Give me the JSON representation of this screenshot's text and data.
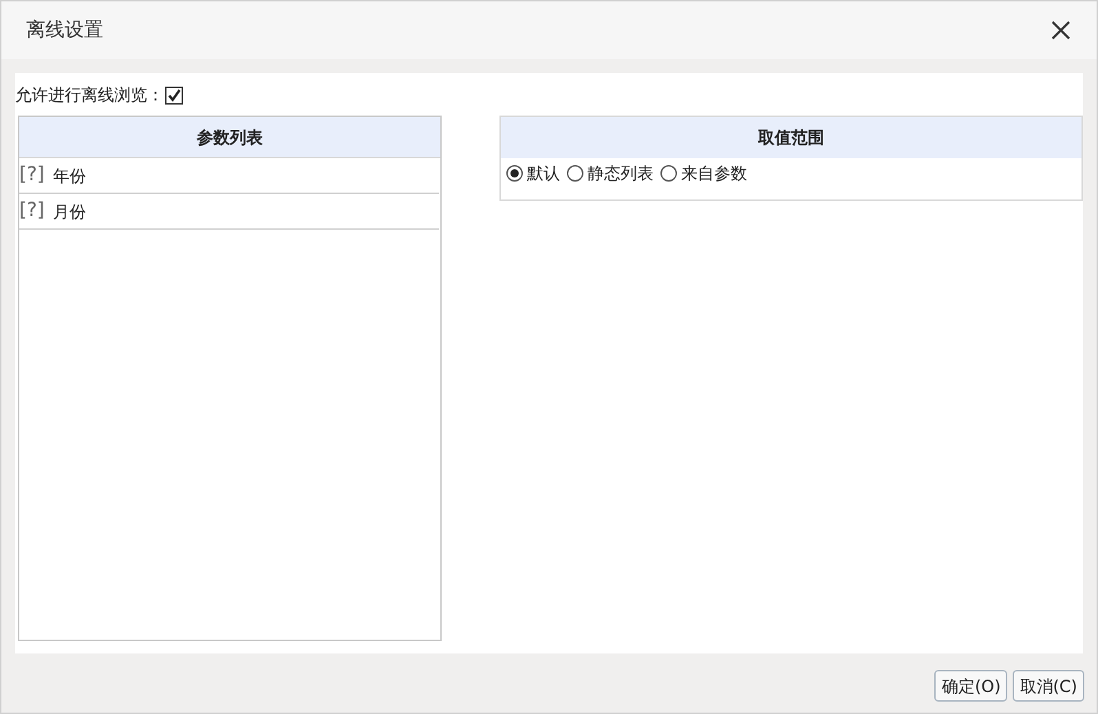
{
  "window": {
    "title": "离线设置"
  },
  "allow_offline": {
    "label": "允许进行离线浏览：",
    "checked": true
  },
  "param_list": {
    "header": "参数列表",
    "items": [
      {
        "icon": "[?]",
        "label": "年份",
        "selected": false
      },
      {
        "icon": "[?]",
        "label": "月份",
        "selected": false
      }
    ]
  },
  "value_range": {
    "header": "取值范围",
    "options": [
      {
        "label": "默认",
        "selected": true
      },
      {
        "label": "静态列表",
        "selected": false
      },
      {
        "label": "来自参数",
        "selected": false
      }
    ]
  },
  "buttons": [
    "确定(O)",
    "取消(C)"
  ]
}
